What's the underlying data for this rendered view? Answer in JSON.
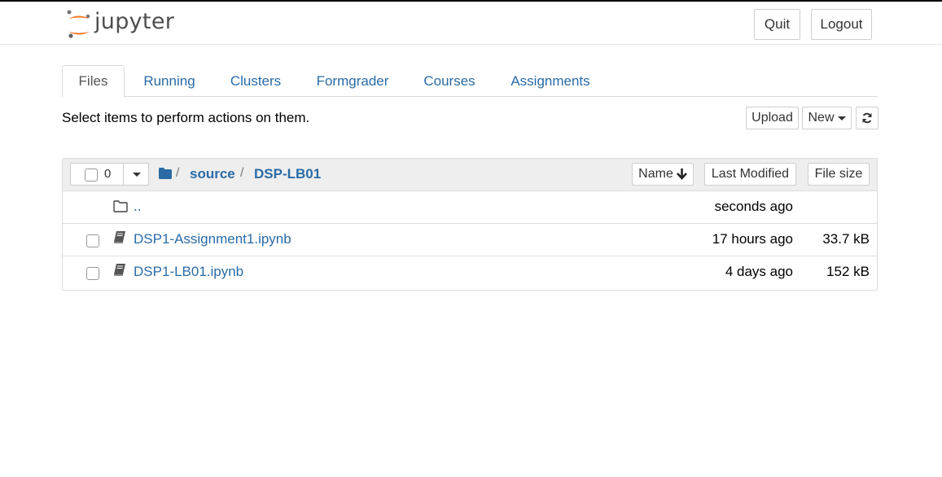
{
  "header": {
    "logo_text": "jupyter",
    "quit_label": "Quit",
    "logout_label": "Logout"
  },
  "tabs": [
    {
      "label": "Files",
      "active": true
    },
    {
      "label": "Running",
      "active": false
    },
    {
      "label": "Clusters",
      "active": false
    },
    {
      "label": "Formgrader",
      "active": false
    },
    {
      "label": "Courses",
      "active": false
    },
    {
      "label": "Assignments",
      "active": false
    }
  ],
  "toolbar": {
    "hint": "Select items to perform actions on them.",
    "upload_label": "Upload",
    "new_label": "New",
    "refresh_icon": "refresh-icon"
  },
  "list": {
    "selected_count": "0",
    "breadcrumb": {
      "separator": "/",
      "items": [
        "source",
        "DSP-LB01"
      ]
    },
    "columns": {
      "name": "Name",
      "last_modified": "Last Modified",
      "file_size": "File size"
    },
    "parent": {
      "name": "..",
      "modified": "seconds ago"
    },
    "files": [
      {
        "name": "DSP1-Assignment1.ipynb",
        "modified": "17 hours ago",
        "size": "33.7 kB"
      },
      {
        "name": "DSP1-LB01.ipynb",
        "modified": "4 days ago",
        "size": "152 kB"
      }
    ]
  },
  "colors": {
    "link": "#2a6ba6",
    "logo_orange": "#f37726"
  }
}
